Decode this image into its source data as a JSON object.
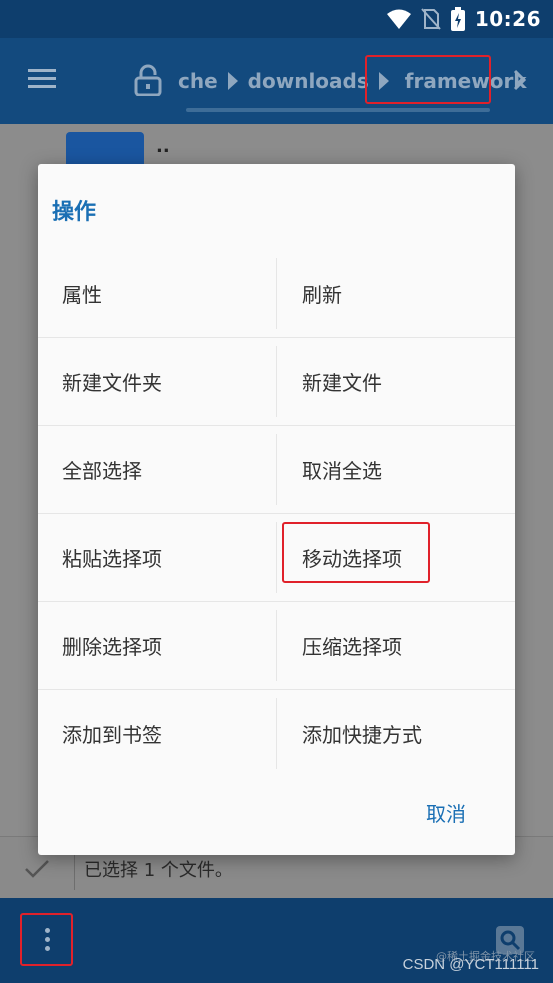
{
  "status_bar": {
    "time": "10:26"
  },
  "toolbar": {
    "breadcrumb": [
      "che",
      "downloads",
      "framework"
    ]
  },
  "file_list": {
    "parent_label": ".."
  },
  "selection_bar": {
    "text": "已选择 1 个文件。"
  },
  "dialog": {
    "title": "操作",
    "rows": [
      {
        "left": "属性",
        "right": "刷新"
      },
      {
        "left": "新建文件夹",
        "right": "新建文件"
      },
      {
        "left": "全部选择",
        "right": "取消全选"
      },
      {
        "left": "粘贴选择项",
        "right": "移动选择项"
      },
      {
        "left": "删除选择项",
        "right": "压缩选择项"
      },
      {
        "left": "添加到书签",
        "right": "添加快捷方式"
      }
    ],
    "cancel_label": "取消"
  },
  "watermark": {
    "small": "@稀土掘金技术社区",
    "main": "CSDN @YCT111111"
  },
  "colors": {
    "accent": "#1a6fb4",
    "toolbar": "#134a7e",
    "highlight": "#e0212a"
  }
}
